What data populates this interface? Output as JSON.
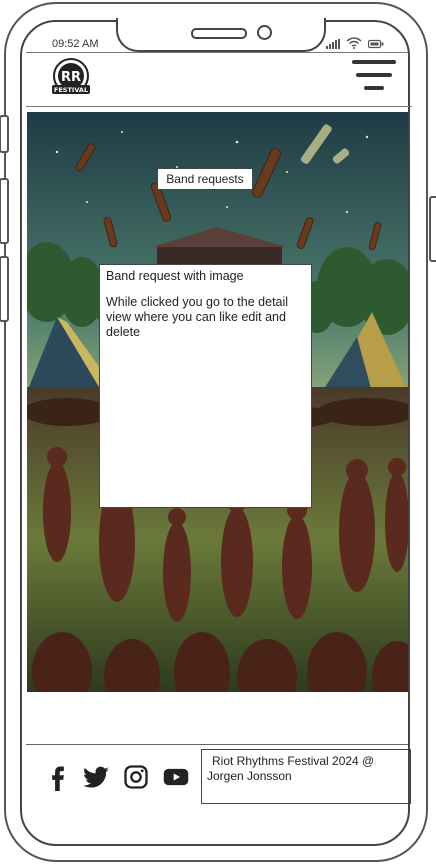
{
  "status_bar": {
    "time": "09:52 AM"
  },
  "header": {
    "logo_text": "RR",
    "logo_subtext": "FESTIVAL",
    "menu_icon": "hamburger-icon"
  },
  "hero": {
    "title": "Band requests"
  },
  "card": {
    "heading": "Band request with image",
    "description": "While clicked you go to the detail view where you can like edit and delete"
  },
  "footer": {
    "social_icons": [
      "facebook-icon",
      "twitter-icon",
      "instagram-icon",
      "youtube-icon"
    ],
    "copyright_line1": "Riot Rhythms Festival 2024 @",
    "copyright_line2": "Jorgen Jonsson"
  }
}
